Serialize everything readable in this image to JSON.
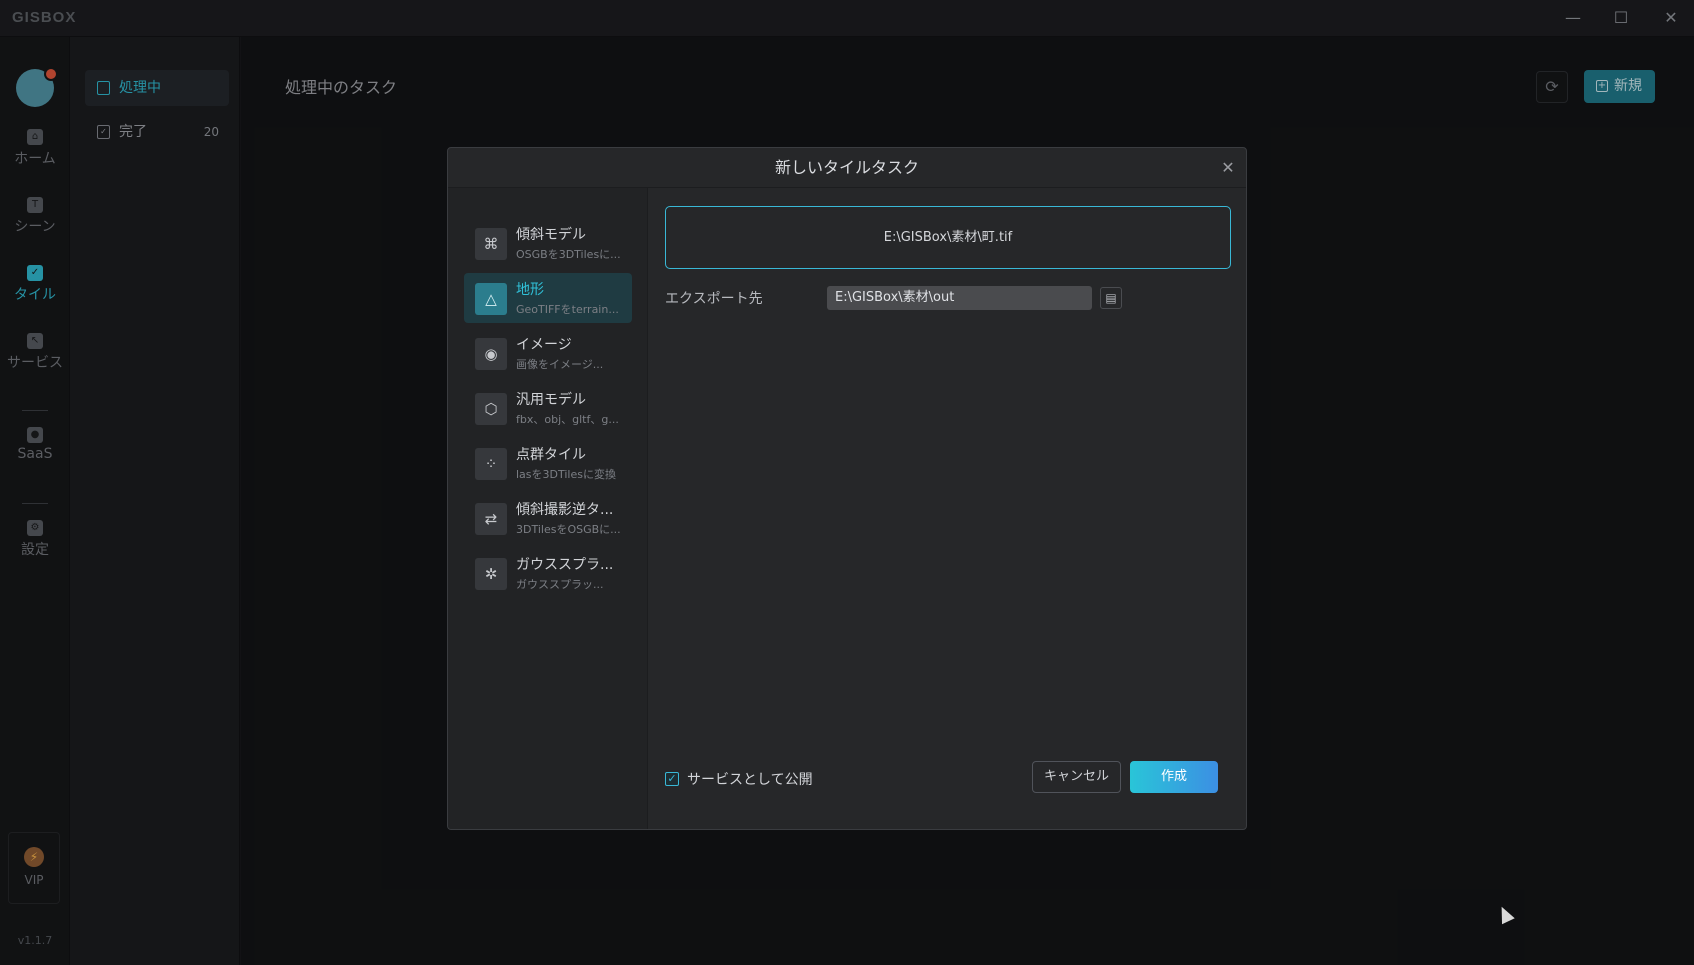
{
  "app": {
    "logo": "GISBOX",
    "window_controls": {
      "minimize": "—",
      "maximize": "☐",
      "close": "✕"
    },
    "version": "v1.1.7"
  },
  "leftnav": {
    "items": [
      {
        "label": "ホーム",
        "icon": "home-icon"
      },
      {
        "label": "シーン",
        "icon": "scene-icon"
      },
      {
        "label": "タイル",
        "icon": "tile-icon"
      },
      {
        "label": "サービス",
        "icon": "service-icon"
      },
      {
        "label": "SaaS",
        "icon": "lock-icon"
      },
      {
        "label": "設定",
        "icon": "gear-icon"
      }
    ],
    "vip": "VIP"
  },
  "subnav": {
    "items": [
      {
        "label": "処理中",
        "count": ""
      },
      {
        "label": "完了",
        "count": "20"
      }
    ]
  },
  "main": {
    "title": "処理中のタスク",
    "new_button": "新規"
  },
  "dialog": {
    "title": "新しいタイルタスク",
    "tasks": [
      {
        "name": "傾斜モデル",
        "desc": "OSGBを3DTilesに...",
        "icon": "drone-icon"
      },
      {
        "name": "地形",
        "desc": "GeoTIFFをterrain...",
        "icon": "terrain-icon"
      },
      {
        "name": "イメージ",
        "desc": "画像をイメージ...",
        "icon": "image-icon"
      },
      {
        "name": "汎用モデル",
        "desc": "fbx、obj、gltf、g...",
        "icon": "cube-icon"
      },
      {
        "name": "点群タイル",
        "desc": "lasを3DTilesに変換",
        "icon": "point-cloud-icon"
      },
      {
        "name": "傾斜撮影逆タ...",
        "desc": "3DTilesをOSGBに...",
        "icon": "reverse-icon"
      },
      {
        "name": "ガウススプラ...",
        "desc": "ガウススプラッ...",
        "icon": "gaussian-icon"
      }
    ],
    "selected_file": "E:\\GISBox\\素材\\町.tif",
    "export_label": "エクスポート先",
    "export_path": "E:\\GISBox\\素材\\out",
    "publish_label": "サービスとして公開",
    "publish_checked": true,
    "cancel": "キャンセル",
    "create": "作成"
  }
}
